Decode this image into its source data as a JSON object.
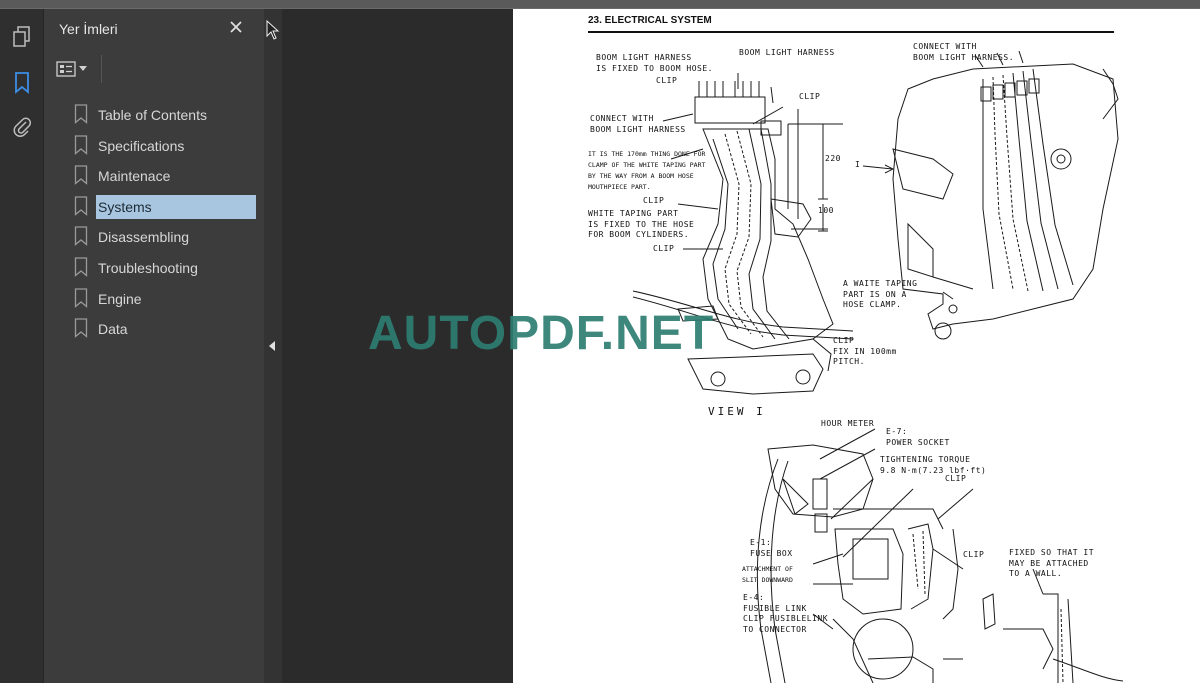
{
  "sidebar": {
    "title": "Yer İmleri",
    "close_icon": "close-icon",
    "options_icon": "bookmark-options-icon",
    "items": [
      {
        "label": "Table of Contents"
      },
      {
        "label": "Specifications"
      },
      {
        "label": "Maintenace"
      },
      {
        "label": "Systems"
      },
      {
        "label": "Disassembling"
      },
      {
        "label": "Troubleshooting"
      },
      {
        "label": "Engine"
      },
      {
        "label": "Data"
      }
    ],
    "selected_index": 3
  },
  "rail": {
    "icons": [
      "pages-icon",
      "bookmarks-icon",
      "attachments-icon"
    ],
    "active_icon": "bookmarks-icon"
  },
  "colors": {
    "accent": "#3d8ee6",
    "selection": "#a8c6df",
    "watermark": "#2e7d72"
  },
  "document": {
    "heading": "23. ELECTRICAL SYSTEM",
    "labels": {
      "boom_fixed": "BOOM LIGHT HARNESS\nIS FIXED TO BOOM HOSE.",
      "boom_harness": "BOOM LIGHT HARNESS",
      "connect_with_right": "CONNECT WITH\nBOOM LIGHT HARNESS.",
      "clip_1": "CLIP",
      "clip_2": "CLIP",
      "connect_with_left": "CONNECT WITH\nBOOM LIGHT HARNESS",
      "note_170": "IT IS THE 170mm THING DONE FOR\nCLAMP OF THE WHITE TAPING PART\nBY THE WAY FROM A BOOM HOSE\nMOUTHPIECE PART.",
      "clip_3": "CLIP",
      "white_taping": "WHITE TAPING PART\nIS FIXED TO THE HOSE\nFOR BOOM CYLINDERS.",
      "clip_4": "CLIP",
      "dim_220": "220",
      "dim_100": "100",
      "mark_i": "I",
      "waite_taping": "A WAITE TAPING\nPART IS ON A\nHOSE CLAMP.",
      "clip_fix": "CLIP\nFIX IN 100mm\nPITCH.",
      "view_i": "VIEW I",
      "hour_meter": "HOUR METER",
      "power_socket": "E-7:\nPOWER SOCKET",
      "torque": "TIGHTENING TORQUE\n9.8 N·m(7.23 lbf·ft)",
      "clip_5": "CLIP",
      "fuse_box": "E-1:\nFUSE BOX",
      "slit": "ATTACHMENT OF\nSLIT DOWNWARD",
      "clip_6": "CLIP",
      "fixed_wall": "FIXED SO THAT IT\nMAY BE ATTACHED\nTO A WALL.",
      "fusible": "E-4:\nFUSIBLE LINK\nCLIP FUSIBLELINK\nTO CONNECTOR"
    }
  },
  "watermark": "AUTOPDF.NET"
}
